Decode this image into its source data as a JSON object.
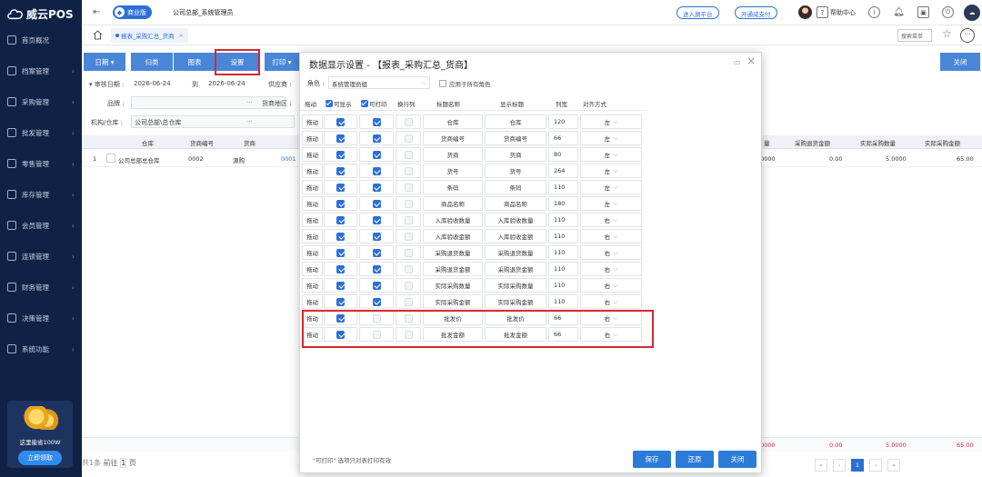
{
  "sidebar": {
    "brand": "威云POS",
    "items": [
      {
        "label": "首页概况",
        "icon": "home-icon"
      },
      {
        "label": "档案管理",
        "icon": "folder-icon"
      },
      {
        "label": "采购管理",
        "icon": "cart-icon"
      },
      {
        "label": "批发管理",
        "icon": "wholesale-icon"
      },
      {
        "label": "零售管理",
        "icon": "store-icon"
      },
      {
        "label": "库存管理",
        "icon": "inventory-icon"
      },
      {
        "label": "会员管理",
        "icon": "member-icon"
      },
      {
        "label": "连锁管理",
        "icon": "chain-icon"
      },
      {
        "label": "财务管理",
        "icon": "finance-icon"
      },
      {
        "label": "决策管理",
        "icon": "decision-icon"
      },
      {
        "label": "系统功能",
        "icon": "system-icon"
      }
    ],
    "promo": {
      "text": "这里能省100W",
      "button": "立即领取"
    }
  },
  "topbar": {
    "edition": "商业版",
    "company": "公司总部_系统管理员",
    "link1": "进入旗平台",
    "link2": "开通威支付",
    "help": "帮助中心"
  },
  "tabs": {
    "active": "报表_采购汇总_货商"
  },
  "menu_search": {
    "placeholder": "搜索菜单"
  },
  "toolbar": {
    "date": "日期",
    "group": "归类",
    "chart": "图表",
    "settings": "设置",
    "print": "打印",
    "close": "关闭"
  },
  "filters": {
    "audit_date_label": "审核日期 :",
    "date_from": "2026-06-24",
    "to": "到",
    "date_to": "2026-06-24",
    "supplier_label": "供应商 :",
    "brand_label": "品牌 :",
    "region_label": "货商地区 :",
    "org_label": "机构/仓库 :",
    "org_value": "公司总部\\总仓库"
  },
  "grid": {
    "headers": [
      "仓库",
      "货商编号",
      "货商",
      "量",
      "采购退货金额",
      "实际采购数量",
      "实际采购金额"
    ],
    "row": {
      "index": "1",
      "warehouse": "公司总部总仓库",
      "code": "0002",
      "supplier": "源购",
      "partial": "0001",
      "qty": ".0000",
      "return_amt": "0.00",
      "actual_qty": "5.0000",
      "actual_amt": "65.00"
    },
    "sum": {
      "qty": ".0000",
      "return_amt": "0.00",
      "actual_qty": "5.0000",
      "actual_amt": "65.00"
    },
    "pager": {
      "total": "共1条",
      "page": "1",
      "goto": "前往",
      "goto_page": "1",
      "unit": "页"
    }
  },
  "dialog": {
    "title": "数据显示设置 - 【报表_采购汇总_货商】",
    "role_label": "角色 :",
    "role_value": "系统管理员组",
    "apply_all": "应用于所有角色",
    "headers": {
      "drag": "拖动",
      "show": "可显示",
      "print": "可打印",
      "wrap": "换行列",
      "title": "标题名称",
      "display": "显示标题",
      "width": "列宽",
      "align": "对齐方式"
    },
    "rows": [
      {
        "drag": "拖动",
        "show": true,
        "print": true,
        "title": "仓库",
        "display": "仓库",
        "width": "120",
        "align": "左"
      },
      {
        "drag": "拖动",
        "show": true,
        "print": true,
        "title": "货商编号",
        "display": "货商编号",
        "width": "66",
        "align": "左"
      },
      {
        "drag": "拖动",
        "show": true,
        "print": true,
        "title": "货商",
        "display": "货商",
        "width": "80",
        "align": "左"
      },
      {
        "drag": "拖动",
        "show": true,
        "print": true,
        "title": "货号",
        "display": "货号",
        "width": "264",
        "align": "左"
      },
      {
        "drag": "拖动",
        "show": true,
        "print": true,
        "title": "条码",
        "display": "条码",
        "width": "110",
        "align": "左"
      },
      {
        "drag": "拖动",
        "show": true,
        "print": true,
        "title": "商品名称",
        "display": "商品名称",
        "width": "180",
        "align": "左"
      },
      {
        "drag": "拖动",
        "show": true,
        "print": true,
        "title": "入库验收数量",
        "display": "入库验收数量",
        "width": "110",
        "align": "右"
      },
      {
        "drag": "拖动",
        "show": true,
        "print": true,
        "title": "入库验收金额",
        "display": "入库验收金额",
        "width": "110",
        "align": "右"
      },
      {
        "drag": "拖动",
        "show": true,
        "print": true,
        "title": "采购退货数量",
        "display": "采购退货数量",
        "width": "110",
        "align": "右"
      },
      {
        "drag": "拖动",
        "show": true,
        "print": true,
        "title": "采购退货金额",
        "display": "采购退货金额",
        "width": "110",
        "align": "右"
      },
      {
        "drag": "拖动",
        "show": true,
        "print": true,
        "title": "实际采购数量",
        "display": "实际采购数量",
        "width": "110",
        "align": "右"
      },
      {
        "drag": "拖动",
        "show": true,
        "print": true,
        "title": "实际采购金额",
        "display": "实际采购金额",
        "width": "110",
        "align": "右"
      },
      {
        "drag": "拖动",
        "show": true,
        "print": false,
        "title": "批发价",
        "display": "批发价",
        "width": "66",
        "align": "右"
      },
      {
        "drag": "拖动",
        "show": true,
        "print": false,
        "title": "批发金额",
        "display": "批发金额",
        "width": "66",
        "align": "右"
      }
    ],
    "footer_note": "\"可打印\" 选项只对表打印有效",
    "save": "保存",
    "restore": "还原",
    "close": "关闭"
  },
  "colors": {
    "primary": "#2d6fd8",
    "sidebar": "#0f2245",
    "highlight": "#d9262e"
  }
}
